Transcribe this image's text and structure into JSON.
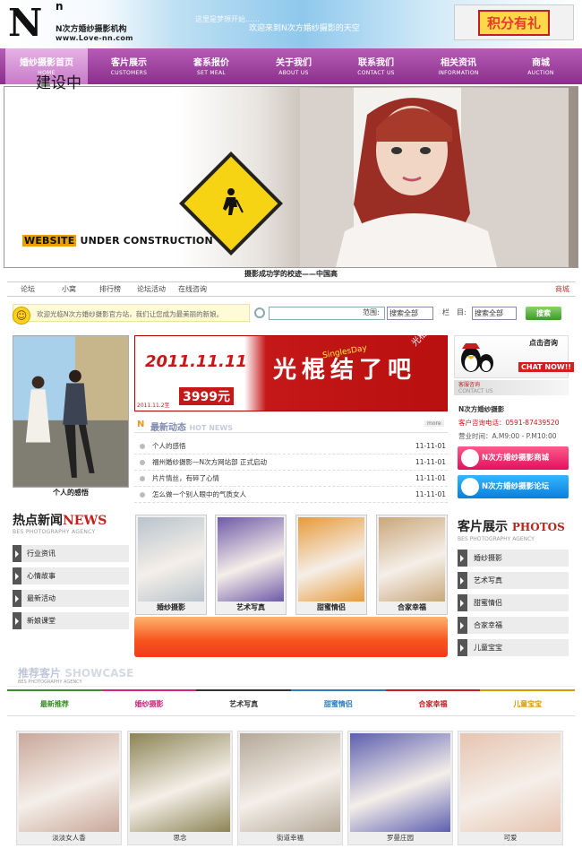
{
  "header": {
    "logo_n": "N",
    "logo_sup": "n",
    "logo_cn": "N次方婚纱摄影机构",
    "logo_url": "www.Love-nn.com",
    "welcome_small": "这里是梦想开始……",
    "welcome": "欢迎来到N次方婚纱摄影的天空",
    "points_banner": "积分有礼"
  },
  "nav": [
    {
      "cn": "婚纱摄影首页",
      "en": "HOME"
    },
    {
      "cn": "客片展示",
      "en": "CUSTOMERS"
    },
    {
      "cn": "套系报价",
      "en": "SET MEAL"
    },
    {
      "cn": "关于我们",
      "en": "ABOUT US"
    },
    {
      "cn": "联系我们",
      "en": "CONTACT US"
    },
    {
      "cn": "相关资讯",
      "en": "INFORMATION"
    },
    {
      "cn": "商城",
      "en": "AUCTION"
    }
  ],
  "banner": {
    "construction_title": "建设中",
    "construction_word": "WEBSITE",
    "construction_rest": " UNDER CONSTRUCTION",
    "caption": "摄影成功学的校迹——中国高"
  },
  "subnav": [
    "论坛",
    "小窝",
    "排行榜",
    "论坛活动",
    "在线咨询"
  ],
  "subnav_shop": "商城",
  "search": {
    "notice": "欢迎光临N次方婚纱摄影官方站，我们让您成为最美丽的新娘。",
    "input_value": "",
    "range_label": "范围:",
    "range_value": "搜索全部",
    "column_label": "栏　目:",
    "column_value": "搜索全部",
    "button": "搜索"
  },
  "left": {
    "photo_caption": "个人的感悟",
    "hot_title": "热点新闻",
    "hot_title_en": "NEWS",
    "hot_sub": "BES PHOTOGRAPHY AGENCY",
    "items": [
      "行业资讯",
      "心情故事",
      "最新活动",
      "新娘课堂"
    ]
  },
  "promo": {
    "date": "2011.11.11",
    "price": "3999元",
    "small": "2011.11.2至",
    "big": "光棍结了吧",
    "tag": "SinglesDay",
    "corner": "光棍节"
  },
  "news": {
    "n": "N",
    "title": "最新动态",
    "title_en": "HOT NEWS",
    "more": "more",
    "rows": [
      {
        "title": "个人的感悟",
        "date": "11-11-01"
      },
      {
        "title": "福州婚纱摄影—N次方网站部  正式启动",
        "date": "11-11-01"
      },
      {
        "title": "片片情丝，有碎了心情",
        "date": "11-11-01"
      },
      {
        "title": "怎么做一个别人眼中的气质女人",
        "date": "11-11-01"
      }
    ]
  },
  "gallery": [
    {
      "caption": "婚纱摄影",
      "color": "#b8c4cc"
    },
    {
      "caption": "艺术写真",
      "color": "#6e5aa8"
    },
    {
      "caption": "甜蜜情侣",
      "color": "#e79a3a"
    },
    {
      "caption": "合家幸福",
      "color": "#c9a77a"
    }
  ],
  "right": {
    "qq_click": "点击咨询",
    "qq_chat": "CHAT NOW!!",
    "kf_cn": "客服咨询",
    "kf_en": "CONTACT US",
    "brand": "N次方婚纱摄影",
    "phone": "客户咨询电话：0591-87439520",
    "hours": "营业时间：A.M9:00 - P.M10:00",
    "weibo": "N次方婚纱摄影商城",
    "forum": "N次方婚纱摄影论坛",
    "kp_title": "客片展示",
    "kp_title_en": "PHOTOS",
    "kp_sub": "BES PHOTOGRAPHY AGENCY",
    "items": [
      "婚纱摄影",
      "艺术写真",
      "甜蜜情侣",
      "合家幸福",
      "儿童宝宝"
    ]
  },
  "showcase": {
    "title": "推荐客片",
    "title_en": "SHOWCASE",
    "sub": "BES PHOTOGRAPHY AGENCY",
    "tabs": [
      {
        "label": "最新推荐",
        "color": "#3a8f2a"
      },
      {
        "label": "婚纱摄影",
        "color": "#d6237a"
      },
      {
        "label": "艺术写真",
        "color": "#333333"
      },
      {
        "label": "甜蜜情侣",
        "color": "#2a7fc4"
      },
      {
        "label": "合家幸福",
        "color": "#c41e1e"
      },
      {
        "label": "儿童宝宝",
        "color": "#d49a00"
      }
    ],
    "photos": [
      {
        "caption": "淡淡女人香",
        "color": "#c9a79a"
      },
      {
        "caption": "思念",
        "color": "#8c8455"
      },
      {
        "caption": "街道幸福",
        "color": "#b4a898"
      },
      {
        "caption": "罗曼庄园",
        "color": "#5d5fb0"
      },
      {
        "caption": "可爱",
        "color": "#e6c4b0"
      }
    ]
  }
}
